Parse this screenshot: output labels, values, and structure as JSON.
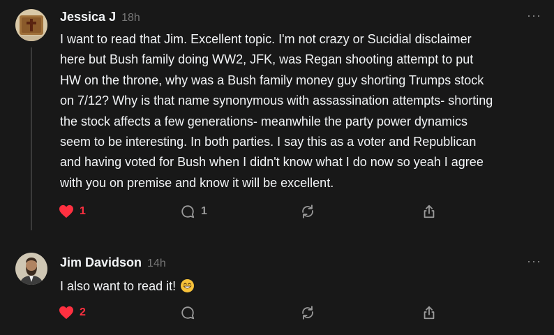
{
  "comments": [
    {
      "author": "Jessica J",
      "time": "18h",
      "more_label": "···",
      "avatar_icon": "cross-plaque-avatar",
      "lines": [
        "I want to read that Jim. Excellent topic. I'm not crazy or Sucidial disclaimer",
        "here but Bush family doing WW2, JFK, was Regan shooting attempt to put",
        "HW on the throne, why was a Bush family money guy shorting Trumps stock",
        "on 7/12? Why is that name synonymous with assassination attempts- shorting",
        "the stock affects a few generations- meanwhile the party power dynamics",
        "seem to be interesting. In both parties. I say this as a voter and Republican",
        "and having voted for Bush when I didn't know what I do now so yeah I agree",
        "with you on premise and know it will be excellent."
      ],
      "likes": "1",
      "replies": "1",
      "liked": true
    },
    {
      "author": "Jim Davidson",
      "time": "14h",
      "more_label": "···",
      "avatar_icon": "bearded-man-avatar",
      "text": "I also want to read it!",
      "emoji": "grinning-face-emoji",
      "likes": "2",
      "replies": "",
      "liked": true
    }
  ],
  "colors": {
    "background": "#181818",
    "text": "#f3f5f7",
    "muted": "#777777",
    "like": "#ff3040"
  }
}
